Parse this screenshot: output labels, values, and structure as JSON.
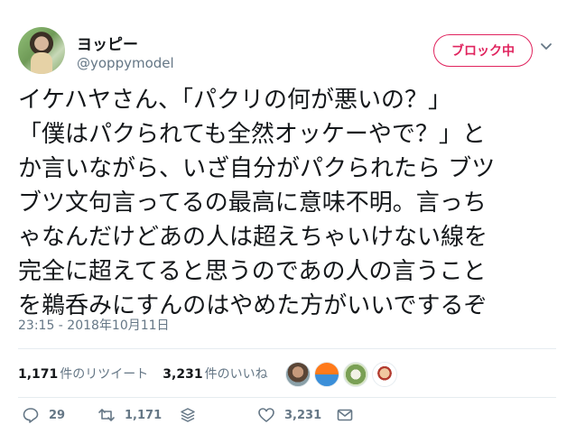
{
  "user": {
    "display_name": "ヨッピー",
    "handle": "@yoppymodel",
    "avatar": "avatar"
  },
  "block_button": {
    "label": "ブロック中",
    "icon": "chevron-down-icon"
  },
  "tweet": {
    "text": "イケハヤさん、「パクリの何が悪いの？」\n「僕はパクられても全然オッケーやで？」と\nか言いながら、いざ自分がパクられたら ブツ\nブツ文句言ってるの最高に意味不明。言っち\nゃなんだけどあの人は超えちゃいけない線を\n完全に超えてると思うのであの人の言うこと\nを鵜呑みにすんのはやめた方がいいでするぞ",
    "timestamp": "23:15 - 2018年10月11日"
  },
  "stats": {
    "retweets_count": "1,171",
    "retweets_label": "件のリツイート",
    "likes_count": "3,231",
    "likes_label": "件のいいね"
  },
  "actions": {
    "reply_count": "29",
    "retweet_count": "1,171",
    "like_count": "3,231"
  },
  "colors": {
    "accent": "#e0245e",
    "secondary_text": "#657786",
    "divider": "#e6ecf0"
  }
}
